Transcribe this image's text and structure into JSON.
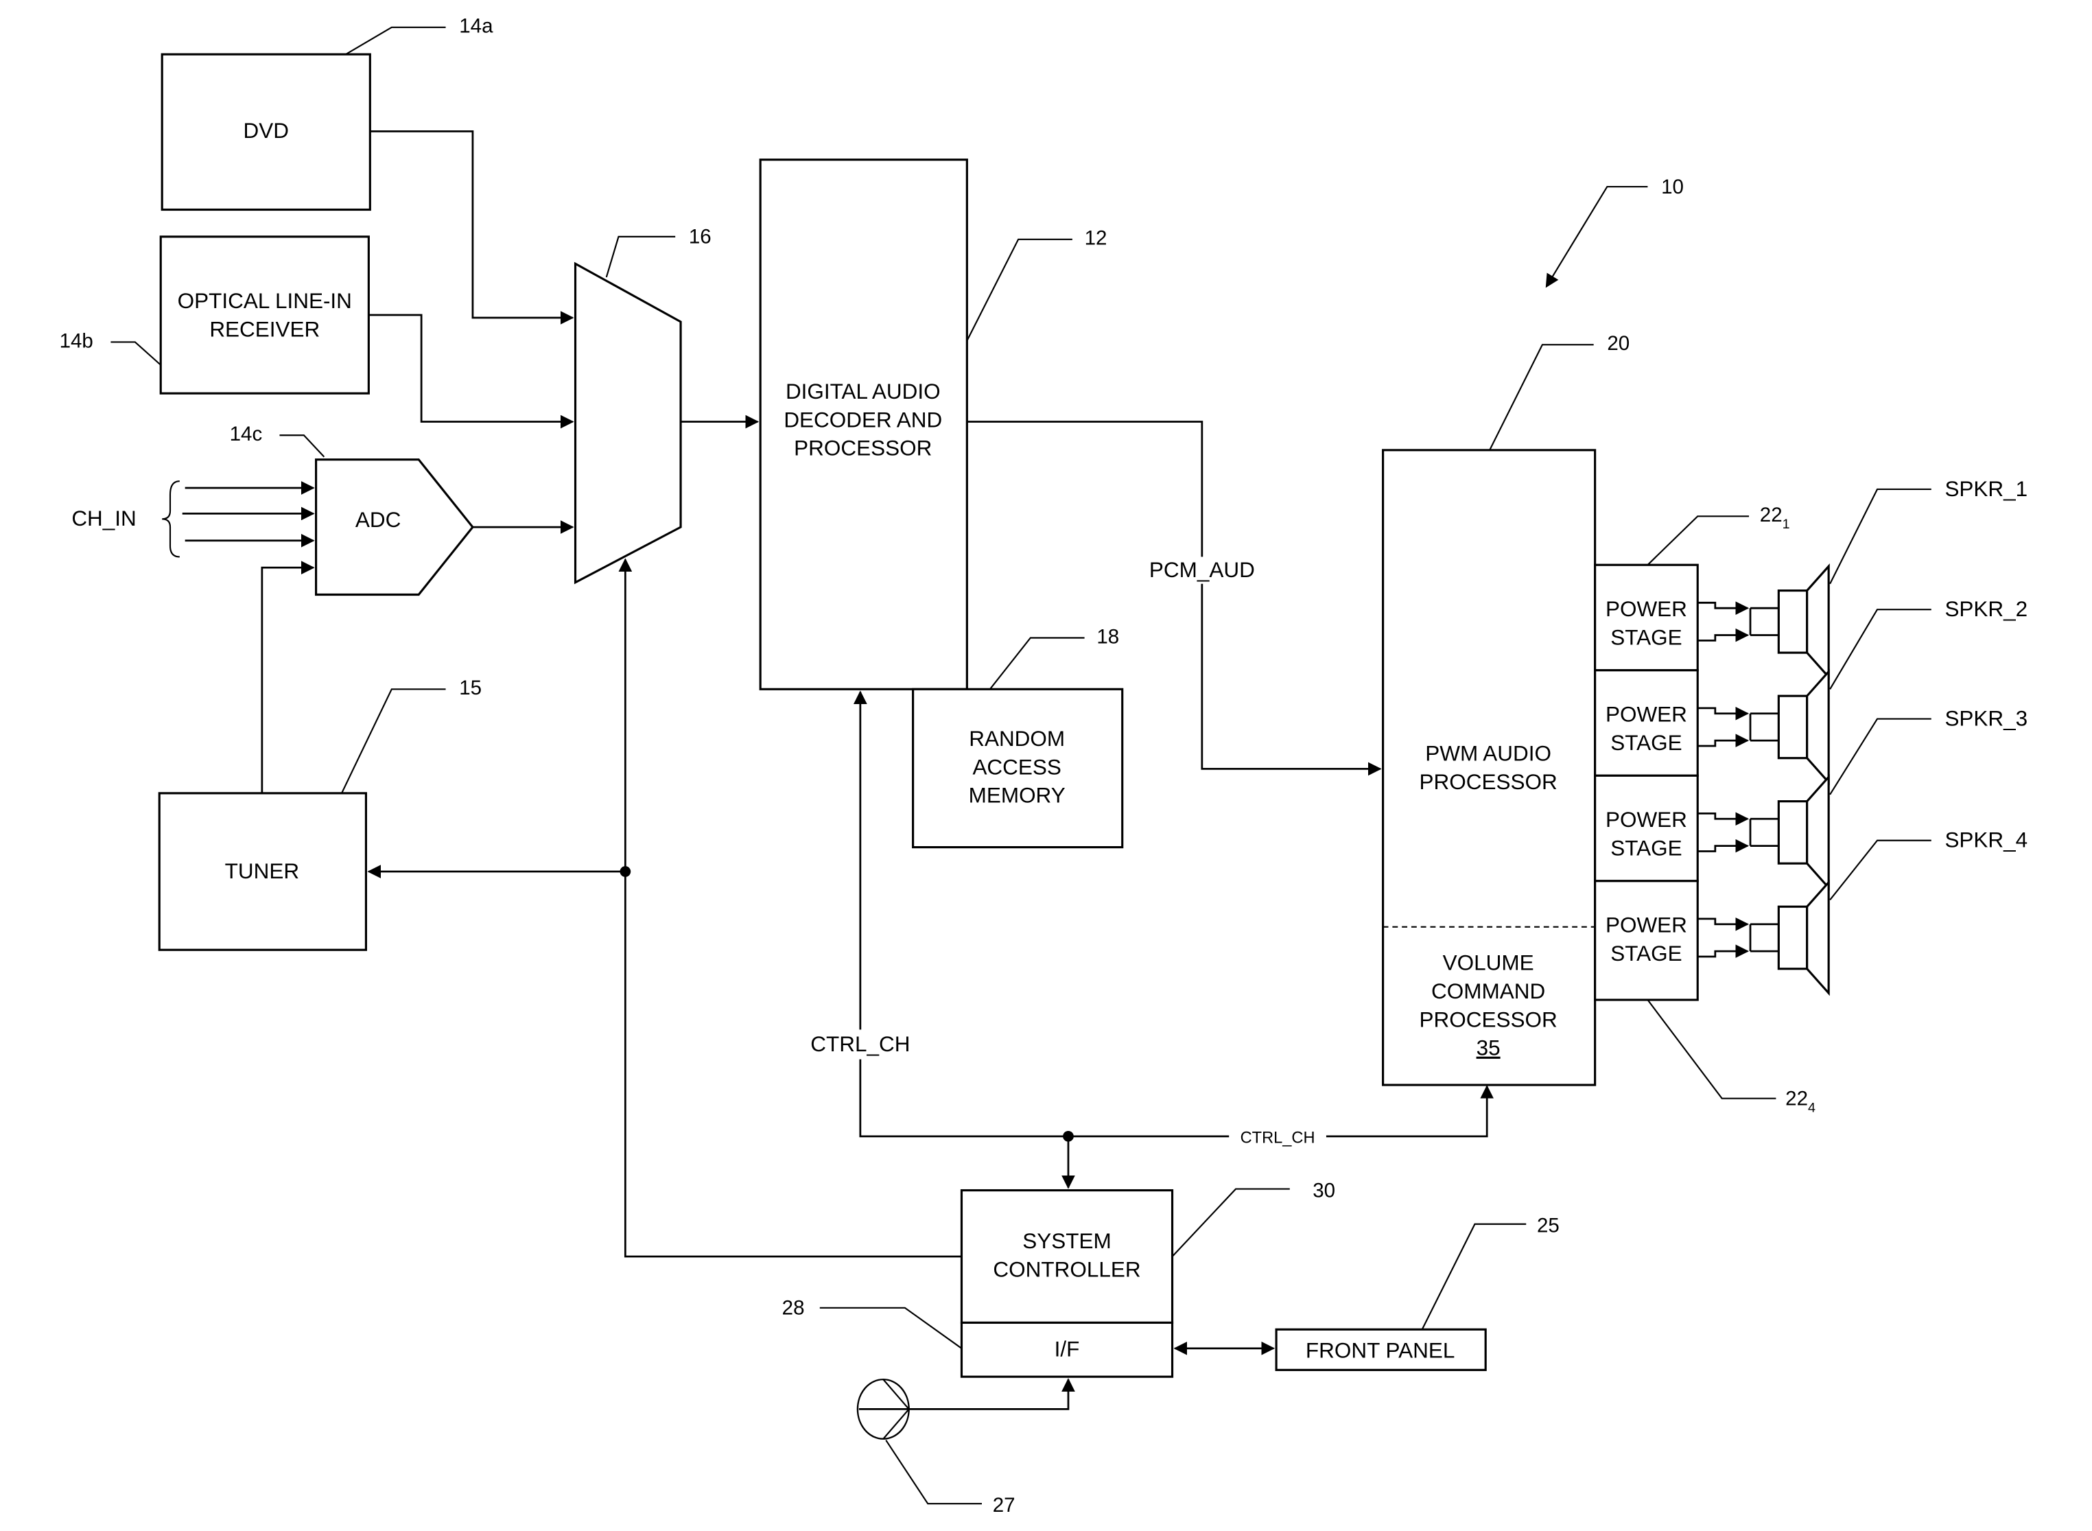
{
  "figure": {
    "system_ref": "10",
    "blocks": {
      "dvd": {
        "label": "DVD",
        "ref": "14a"
      },
      "optical": {
        "label_lines": [
          "OPTICAL LINE-IN",
          "RECEIVER"
        ],
        "ref": "14b"
      },
      "adc": {
        "label": "ADC",
        "ref": "14c"
      },
      "mux": {
        "ref": "16"
      },
      "tuner": {
        "label": "TUNER",
        "ref": "15"
      },
      "decoder": {
        "label_lines": [
          "DIGITAL AUDIO",
          "DECODER AND",
          "PROCESSOR"
        ],
        "ref": "12"
      },
      "ram": {
        "label_lines": [
          "RANDOM",
          "ACCESS",
          "MEMORY"
        ],
        "ref": "18"
      },
      "pwm": {
        "label_lines": [
          "PWM AUDIO",
          "PROCESSOR"
        ],
        "ref": "20"
      },
      "volume": {
        "label_lines": [
          "VOLUME",
          "COMMAND",
          "PROCESSOR"
        ],
        "ref": "35"
      },
      "system_controller": {
        "label_lines": [
          "SYSTEM",
          "CONTROLLER"
        ],
        "ref": "30"
      },
      "interface": {
        "label": "I/F",
        "ref": "28"
      },
      "front_panel": {
        "label": "FRONT PANEL",
        "ref": "25"
      },
      "knob": {
        "ref": "27"
      }
    },
    "power_stages": [
      {
        "label_lines": [
          "POWER",
          "STAGE"
        ]
      },
      {
        "label_lines": [
          "POWER",
          "STAGE"
        ]
      },
      {
        "label_lines": [
          "POWER",
          "STAGE"
        ]
      },
      {
        "label_lines": [
          "POWER",
          "STAGE"
        ]
      }
    ],
    "power_stage_refs": {
      "first": {
        "base": "22",
        "sub": "1"
      },
      "last": {
        "base": "22",
        "sub": "4"
      }
    },
    "speakers": [
      "SPKR_1",
      "SPKR_2",
      "SPKR_3",
      "SPKR_4"
    ],
    "signals": {
      "ch_in": "CH_IN",
      "pcm_aud": "PCM_AUD",
      "ctrl_ch_vertical": "CTRL_CH",
      "ctrl_ch_bus": "CTRL_CH"
    }
  }
}
